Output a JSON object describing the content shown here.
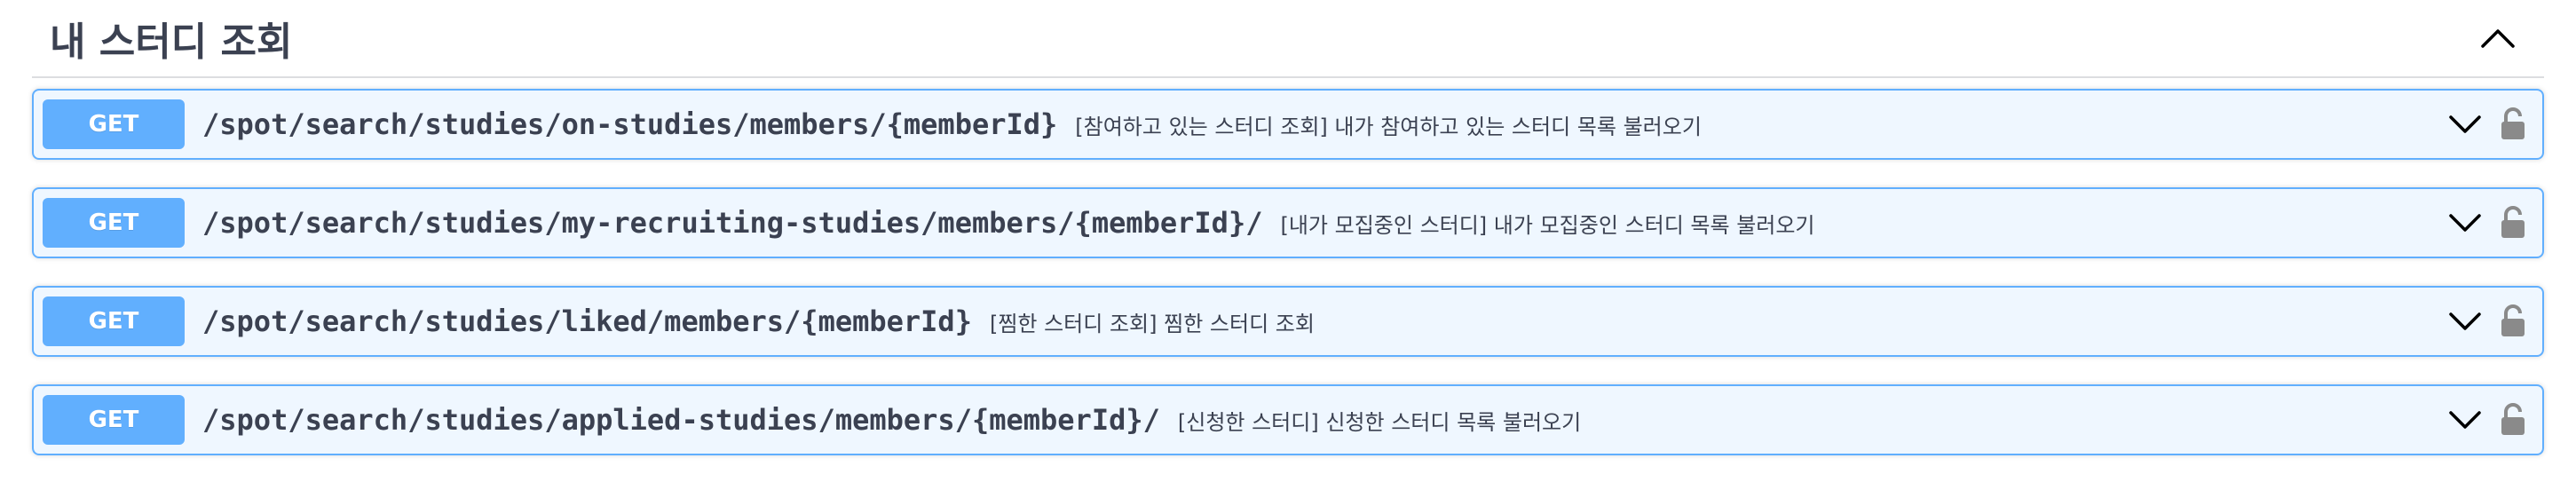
{
  "section": {
    "title": "내 스터디 조회"
  },
  "operations": [
    {
      "method": "GET",
      "path": "/spot/search/studies/on-studies/members/{memberId}",
      "summary": "[참여하고 있는 스터디 조회] 내가 참여하고 있는 스터디 목록 불러오기"
    },
    {
      "method": "GET",
      "path": "/spot/search/studies/my-recruiting-studies/members/{memberId}/",
      "summary": "[내가 모집중인 스터디] 내가 모집중인 스터디 목록 불러오기"
    },
    {
      "method": "GET",
      "path": "/spot/search/studies/liked/members/{memberId}",
      "summary": "[찜한 스터디 조회] 찜한 스터디 조회"
    },
    {
      "method": "GET",
      "path": "/spot/search/studies/applied-studies/members/{memberId}/",
      "summary": "[신청한 스터디] 신청한 스터디 목록 불러오기"
    }
  ],
  "colors": {
    "get_accent": "#61affe",
    "text": "#3b4151",
    "lock": "#8a8a8a"
  },
  "icons": {
    "collapse": "chevron-up-icon",
    "expand": "chevron-down-icon",
    "auth": "lock-icon"
  }
}
